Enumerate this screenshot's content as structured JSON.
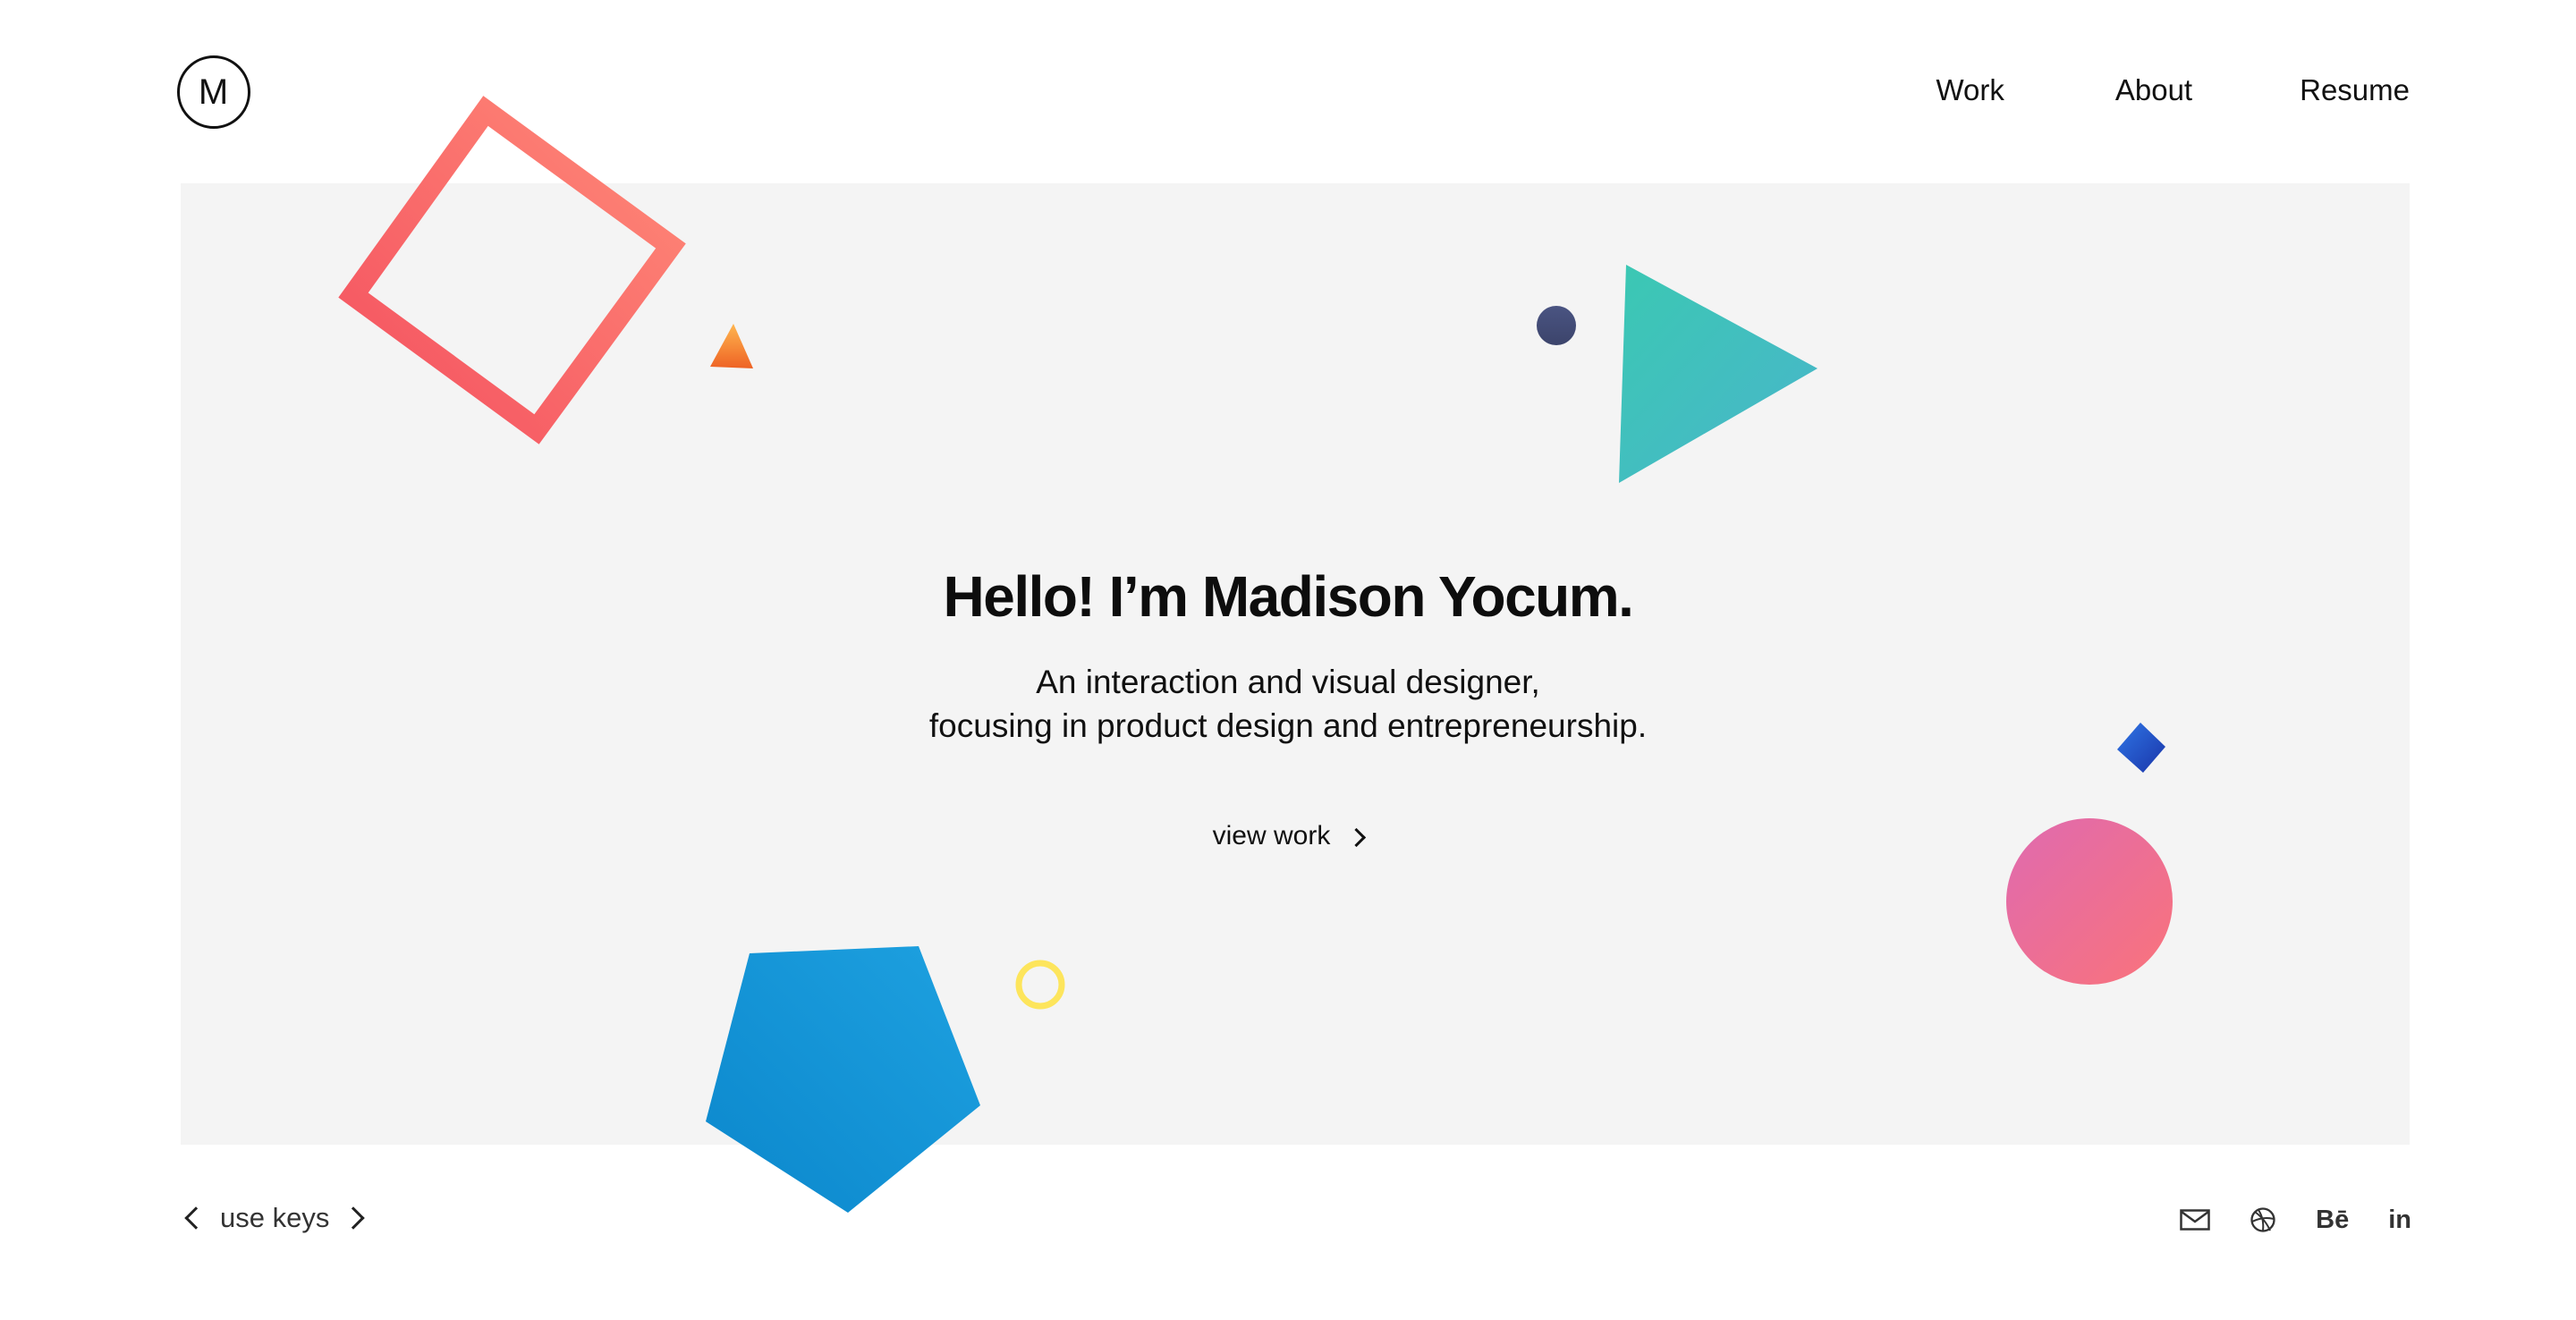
{
  "logo": {
    "letter": "M"
  },
  "nav": {
    "items": [
      {
        "label": "Work"
      },
      {
        "label": "About"
      },
      {
        "label": "Resume"
      }
    ]
  },
  "hero": {
    "title": "Hello! I’m Madison Yocum.",
    "subtitle_line1": "An interaction and visual designer,",
    "subtitle_line2": "focusing in product design and entrepreneurship.",
    "cta_label": "view work"
  },
  "footer": {
    "keys_label": "use keys",
    "social": {
      "behance_label": "Bē",
      "linkedin_label": "in"
    }
  },
  "colors": {
    "panel": "#f4f4f4",
    "square_outline": [
      "#f4505f",
      "#ff8a78"
    ],
    "orange_triangle": [
      "#ffa24a",
      "#f06a28"
    ],
    "navy_dot": "#474f7a",
    "teal_triangle": [
      "#3cc7b6",
      "#47b8c9"
    ],
    "blue_diamond": [
      "#2d6fe0",
      "#1a3bb0"
    ],
    "pink_circle": [
      "#e66aa9",
      "#f7727a"
    ],
    "blue_pentagon": [
      "#0f8fd0",
      "#1c9ee0"
    ],
    "yellow_ring": "#fde55c"
  }
}
